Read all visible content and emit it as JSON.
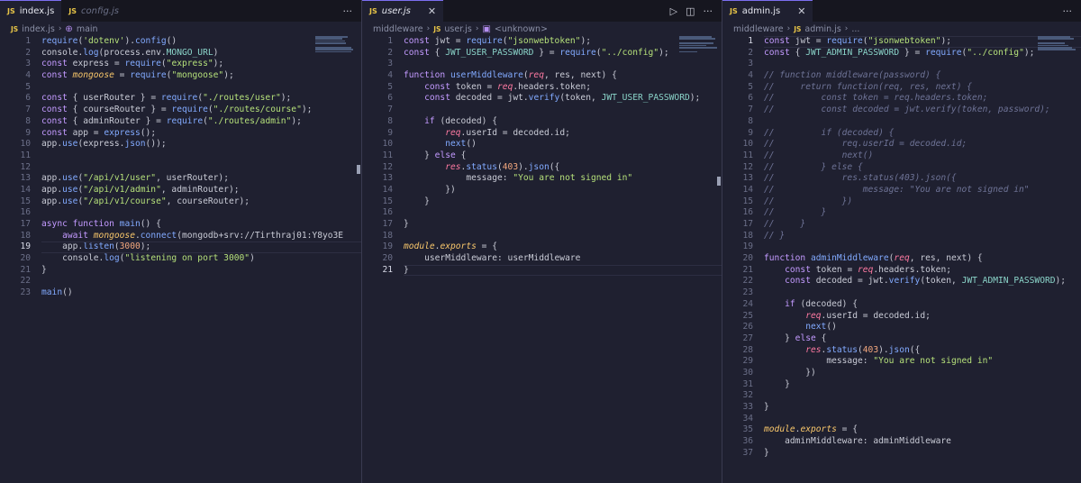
{
  "panes": [
    {
      "tabs": [
        {
          "icon": "JS",
          "label": "index.js",
          "active": true
        },
        {
          "icon": "JS",
          "label": "config.js",
          "active": false
        }
      ],
      "actions": [
        "···"
      ],
      "breadcrumb": [
        "index.js",
        "main"
      ],
      "lines": [
        {
          "n": "1",
          "t": "require('dotenv').config()"
        },
        {
          "n": "2",
          "t": "console.log(process.env.MONGO_URL)"
        },
        {
          "n": "3",
          "t": "const express = require(\"express\");"
        },
        {
          "n": "4",
          "t": "const mongoose = require(\"mongoose\");"
        },
        {
          "n": "5",
          "t": ""
        },
        {
          "n": "6",
          "t": "const { userRouter } = require(\"./routes/user\");"
        },
        {
          "n": "7",
          "t": "const { courseRouter } = require(\"./routes/course\");"
        },
        {
          "n": "8",
          "t": "const { adminRouter } = require(\"./routes/admin\");"
        },
        {
          "n": "9",
          "t": "const app = express();"
        },
        {
          "n": "10",
          "t": "app.use(express.json());"
        },
        {
          "n": "11",
          "t": ""
        },
        {
          "n": "12",
          "t": ""
        },
        {
          "n": "13",
          "t": "app.use(\"/api/v1/user\", userRouter);"
        },
        {
          "n": "14",
          "t": "app.use(\"/api/v1/admin\", adminRouter);"
        },
        {
          "n": "15",
          "t": "app.use(\"/api/v1/course\", courseRouter);"
        },
        {
          "n": "16",
          "t": ""
        },
        {
          "n": "17",
          "t": "async function main() {"
        },
        {
          "n": "18",
          "t": "    await mongoose.connect(\"mongodb+srv://Tirthraj01:Y8yo3E"
        },
        {
          "n": "19",
          "t": "    app.listen(3000);"
        },
        {
          "n": "20",
          "t": "    console.log(\"listening on port 3000\")"
        },
        {
          "n": "21",
          "t": "}"
        },
        {
          "n": "22",
          "t": ""
        },
        {
          "n": "23",
          "t": "main()"
        }
      ],
      "current_line": "19"
    },
    {
      "tabs": [
        {
          "icon": "JS",
          "label": "user.js",
          "active": true,
          "close": "✕"
        }
      ],
      "actions": [
        "▷",
        "◫",
        "···"
      ],
      "breadcrumb": [
        "middleware",
        "user.js",
        "<unknown>"
      ],
      "lines": [
        {
          "n": "1",
          "t": "const jwt = require(\"jsonwebtoken\");"
        },
        {
          "n": "2",
          "t": "const { JWT_USER_PASSWORD } = require(\"../config\");"
        },
        {
          "n": "3",
          "t": ""
        },
        {
          "n": "4",
          "t": "function userMiddleware(req, res, next) {"
        },
        {
          "n": "5",
          "t": "    const token = req.headers.token;"
        },
        {
          "n": "6",
          "t": "    const decoded = jwt.verify(token, JWT_USER_PASSWORD);"
        },
        {
          "n": "7",
          "t": ""
        },
        {
          "n": "8",
          "t": "    if (decoded) {"
        },
        {
          "n": "9",
          "t": "        req.userId = decoded.id;"
        },
        {
          "n": "10",
          "t": "        next()"
        },
        {
          "n": "11",
          "t": "    } else {"
        },
        {
          "n": "12",
          "t": "        res.status(403).json({"
        },
        {
          "n": "13",
          "t": "            message: \"You are not signed in\""
        },
        {
          "n": "14",
          "t": "        })"
        },
        {
          "n": "15",
          "t": "    }"
        },
        {
          "n": "16",
          "t": ""
        },
        {
          "n": "17",
          "t": "}"
        },
        {
          "n": "18",
          "t": ""
        },
        {
          "n": "19",
          "t": "module.exports = {"
        },
        {
          "n": "20",
          "t": "    userMiddleware: userMiddleware"
        },
        {
          "n": "21",
          "t": "}"
        }
      ],
      "current_line": "21"
    },
    {
      "tabs": [
        {
          "icon": "JS",
          "label": "admin.js",
          "active": true,
          "close": "✕"
        }
      ],
      "actions": [
        "···"
      ],
      "breadcrumb": [
        "middleware",
        "admin.js",
        "..."
      ],
      "lines": [
        {
          "n": "1",
          "t": "const jwt = require(\"jsonwebtoken\");"
        },
        {
          "n": "2",
          "t": "const { JWT_ADMIN_PASSWORD } = require(\"../config\");"
        },
        {
          "n": "3",
          "t": ""
        },
        {
          "n": "4",
          "t": "// function middleware(password) {"
        },
        {
          "n": "5",
          "t": "//     return function(req, res, next) {"
        },
        {
          "n": "6",
          "t": "//         const token = req.headers.token;"
        },
        {
          "n": "7",
          "t": "//         const decoded = jwt.verify(token, password);"
        },
        {
          "n": "8",
          "t": ""
        },
        {
          "n": "9",
          "t": "//         if (decoded) {"
        },
        {
          "n": "10",
          "t": "//             req.userId = decoded.id;"
        },
        {
          "n": "11",
          "t": "//             next()"
        },
        {
          "n": "12",
          "t": "//         } else {"
        },
        {
          "n": "13",
          "t": "//             res.status(403).json({"
        },
        {
          "n": "14",
          "t": "//                 message: \"You are not signed in\""
        },
        {
          "n": "15",
          "t": "//             })"
        },
        {
          "n": "16",
          "t": "//         }"
        },
        {
          "n": "17",
          "t": "//     }"
        },
        {
          "n": "18",
          "t": "// }"
        },
        {
          "n": "19",
          "t": ""
        },
        {
          "n": "20",
          "t": "function adminMiddleware(req, res, next) {"
        },
        {
          "n": "21",
          "t": "    const token = req.headers.token;"
        },
        {
          "n": "22",
          "t": "    const decoded = jwt.verify(token, JWT_ADMIN_PASSWORD);"
        },
        {
          "n": "23",
          "t": ""
        },
        {
          "n": "24",
          "t": "    if (decoded) {"
        },
        {
          "n": "25",
          "t": "        req.userId = decoded.id;"
        },
        {
          "n": "26",
          "t": "        next()"
        },
        {
          "n": "27",
          "t": "    } else {"
        },
        {
          "n": "28",
          "t": "        res.status(403).json({"
        },
        {
          "n": "29",
          "t": "            message: \"You are not signed in\""
        },
        {
          "n": "30",
          "t": "        })"
        },
        {
          "n": "31",
          "t": "    }"
        },
        {
          "n": "32",
          "t": ""
        },
        {
          "n": "33",
          "t": "}"
        },
        {
          "n": "34",
          "t": ""
        },
        {
          "n": "35",
          "t": "module.exports = {"
        },
        {
          "n": "36",
          "t": "    adminMiddleware: adminMiddleware"
        },
        {
          "n": "37",
          "t": "}"
        }
      ],
      "current_line": "1"
    }
  ],
  "colors": {
    "background": "#1f2030",
    "keyword": "#c39aff",
    "string": "#b5e07a",
    "function": "#82aaff",
    "comment": "#6e7396"
  }
}
